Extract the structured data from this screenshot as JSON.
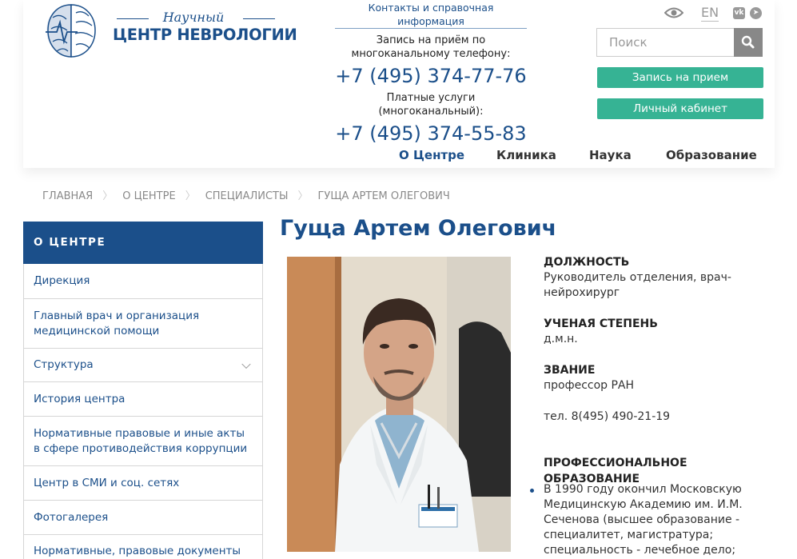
{
  "header": {
    "logo": {
      "subtitle": "Научный",
      "title": "ЦЕНТР НЕВРОЛОГИИ"
    },
    "contacts": {
      "link": "Контакты и справочная информация",
      "label1_line1": "Запись на приём по",
      "label1_line2": "многоканальному телефону:",
      "phone1": "+7 (495) 374-77-76",
      "label2_line1": "Платные услуги",
      "label2_line2": "(многоканальный):",
      "phone2": "+7 (495) 374-55-83"
    },
    "lang": "EN",
    "search_placeholder": "Поиск",
    "btn_appointment": "Запись на прием",
    "btn_cabinet": "Личный кабинет",
    "nav": [
      "О Центре",
      "Клиника",
      "Наука",
      "Образование"
    ]
  },
  "breadcrumb": [
    "ГЛАВНАЯ",
    "О ЦЕНТРЕ",
    "СПЕЦИАЛИСТЫ",
    "ГУЩА АРТЕМ ОЛЕГОВИЧ"
  ],
  "sidebar": {
    "heading": "О ЦЕНТРЕ",
    "items": [
      "Дирекция",
      "Главный врач и организация медицинской помощи",
      "Структура",
      "История центра",
      "Нормативные правовые и иные акты в сфере противодействия коррупции",
      "Центр в СМИ и соц. сетях",
      "Фотогалерея",
      "Нормативные, правовые документы"
    ]
  },
  "profile": {
    "name": "Гуща Артем Олегович",
    "position_label": "ДОЛЖНОСТЬ",
    "position_value": "Руководитель отделения, врач-нейрохирург",
    "degree_label": "УЧЕНАЯ СТЕПЕНЬ",
    "degree_value": "д.м.н.",
    "rank_label": "ЗВАНИЕ",
    "rank_value": "профессор РАН",
    "phone": "тел. 8(495) 490-21-19",
    "edu_label": "ПРОФЕССИОНАЛЬНОЕ ОБРАЗОВАНИЕ",
    "edu_item": "В 1990 году окончил Московскую Медицинскую Академию им. И.М. Сеченова (высшее образование - специалитет, магистратура; специальность - лечебное дело;"
  },
  "colors": {
    "brand": "#1b4f8a",
    "accent_green": "#36b394"
  }
}
